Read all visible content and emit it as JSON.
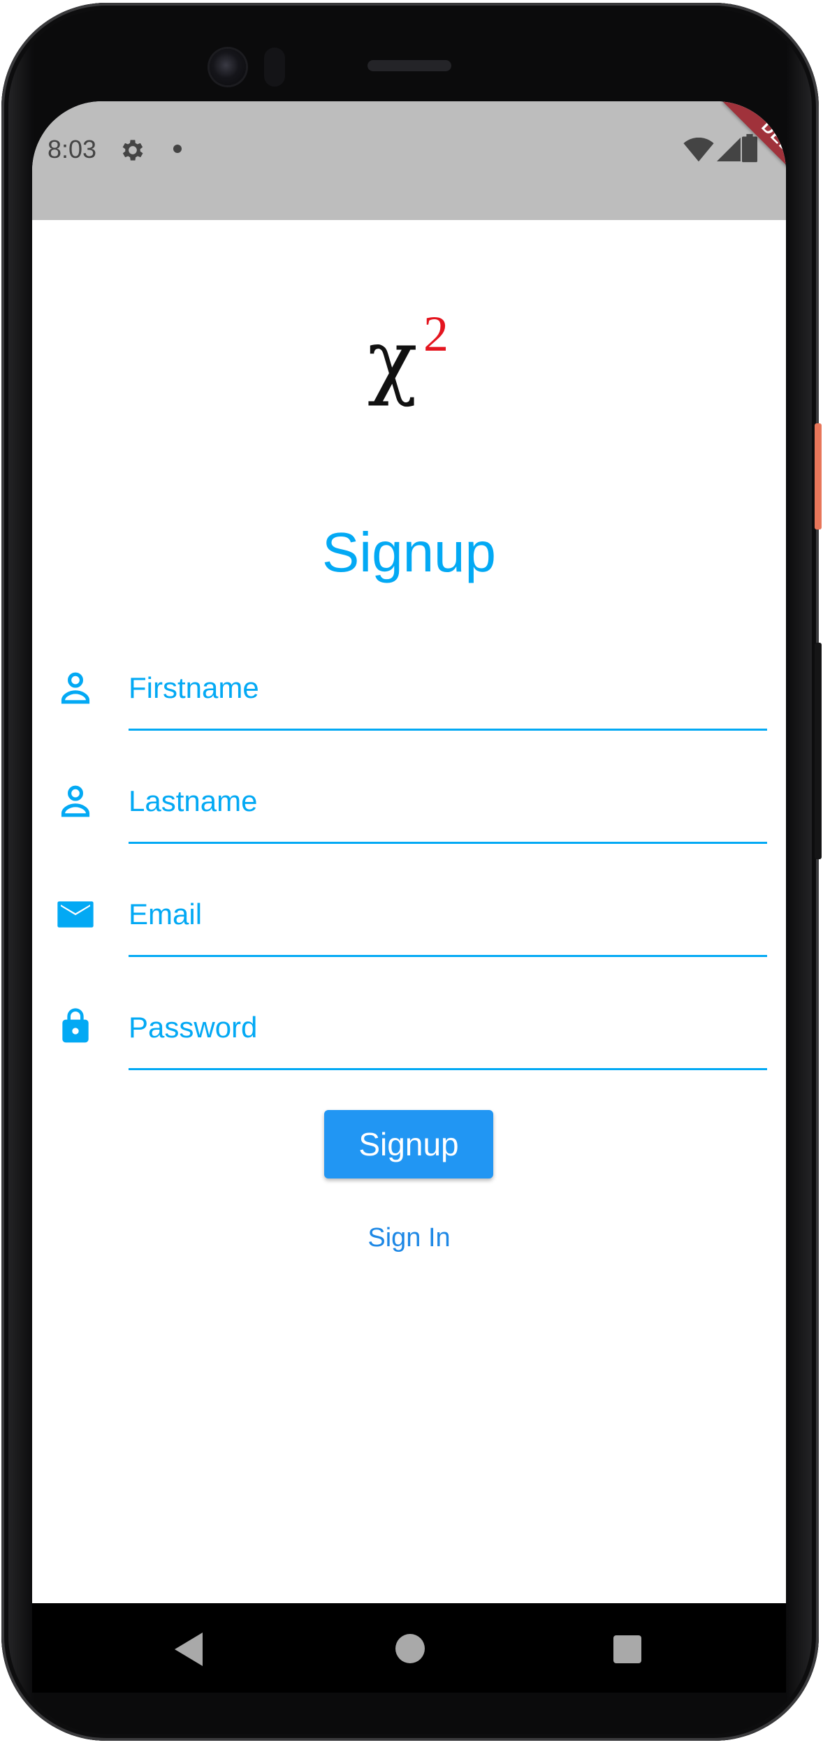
{
  "status_bar": {
    "time": "8:03",
    "debug_label": "DEBUG"
  },
  "logo": {
    "symbol": "χ",
    "superscript": "2"
  },
  "page": {
    "title": "Signup"
  },
  "form": {
    "fields": [
      {
        "placeholder": "Firstname",
        "value": "",
        "icon": "person-icon"
      },
      {
        "placeholder": "Lastname",
        "value": "",
        "icon": "person-icon"
      },
      {
        "placeholder": "Email",
        "value": "",
        "icon": "mail-icon"
      },
      {
        "placeholder": "Password",
        "value": "",
        "icon": "lock-icon"
      }
    ],
    "submit_label": "Signup",
    "signin_label": "Sign In"
  },
  "colors": {
    "accent": "#03a9f4",
    "button": "#2196f3",
    "link": "#1e88e5",
    "status_bar": "#bdbdbd",
    "debug_ribbon": "#a0323b",
    "logo_superscript": "#e4151f"
  }
}
